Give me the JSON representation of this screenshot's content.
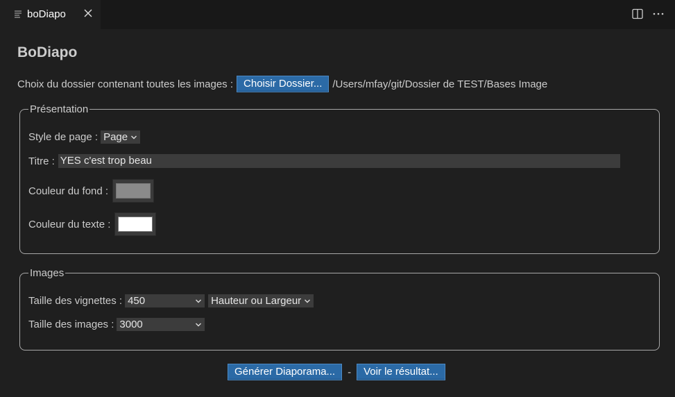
{
  "tab": {
    "label": "boDiapo"
  },
  "page": {
    "title": "BoDiapo"
  },
  "folder": {
    "label": "Choix du dossier contenant toutes les images :",
    "button_label": "Choisir Dossier...",
    "path": "/Users/mfay/git/Dossier de TEST/Bases Image"
  },
  "presentation": {
    "legend": "Présentation",
    "style_label": "Style de page :",
    "style_value": "Page",
    "title_label": "Titre :",
    "title_value": "YES c'est trop beau",
    "bg_label": "Couleur du fond :",
    "bg_color": "#8a8a8a",
    "text_color_label": "Couleur du texte :",
    "text_color": "#ffffff"
  },
  "images": {
    "legend": "Images",
    "thumb_label": "Taille des vignettes :",
    "thumb_value": "450",
    "thumb_dim_value": "Hauteur ou Largeur",
    "image_label": "Taille des images :",
    "image_value": "3000"
  },
  "actions": {
    "generate_label": "Générer Diaporama...",
    "separator": "-",
    "view_label": "Voir le résultat..."
  },
  "icons": [
    "document-lines-icon",
    "close-icon",
    "split-editor-icon",
    "more-icon",
    "chevron-down-icon"
  ]
}
